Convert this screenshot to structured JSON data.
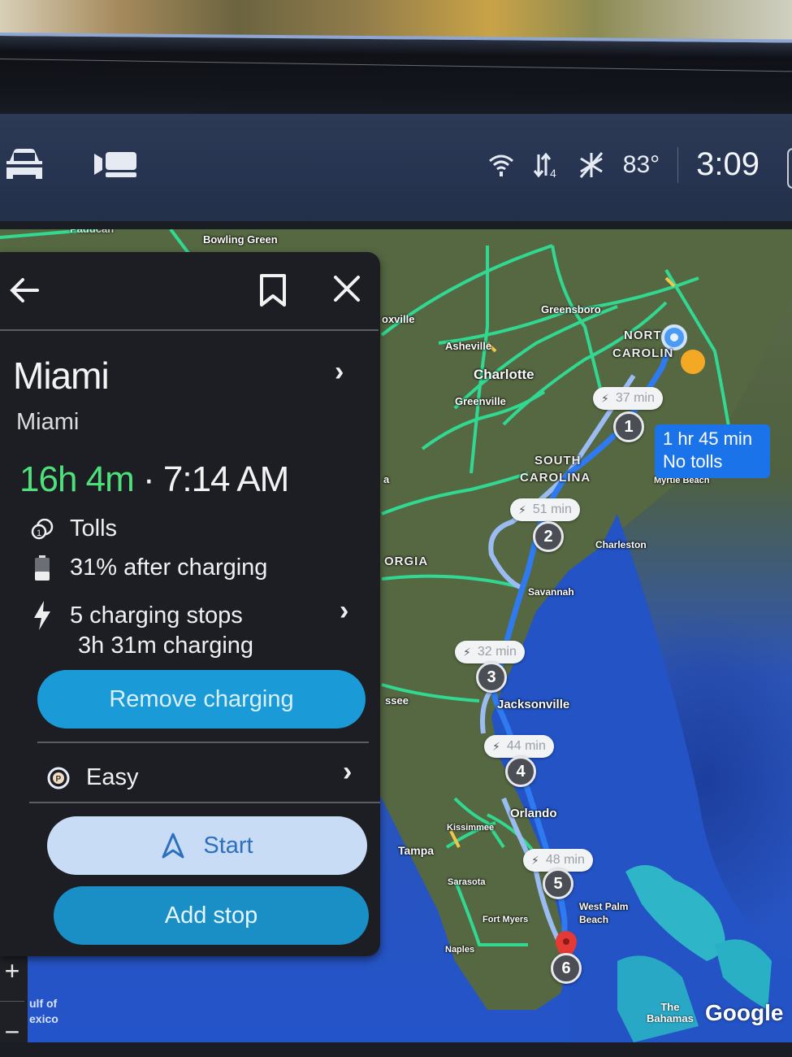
{
  "status_bar": {
    "icons": [
      "car-icon",
      "camera-icon",
      "wifi-icon",
      "data-transfer-icon",
      "climate-off-icon"
    ],
    "data_signal_label": "4",
    "temperature": "83°",
    "time": "3:09"
  },
  "panel": {
    "destination_title": "Miami",
    "destination_subtitle": "Miami",
    "duration": "16h 4m",
    "separator": "·",
    "arrival_time": "7:14 AM",
    "tolls_label": "Tolls",
    "battery_label": "31% after charging",
    "charging_stops_label": "5 charging stops",
    "charging_time_label": "3h 31m charging",
    "remove_charging_label": "Remove charging",
    "parking_label": "Easy",
    "start_label": "Start",
    "add_stop_label": "Add stop"
  },
  "map": {
    "labels": {
      "paducah": "Paducah",
      "bowling_green": "Bowling Green",
      "knoxville": "oxville",
      "asheville": "Asheville",
      "greensboro": "Greensboro",
      "charlotte": "Charlotte",
      "greenville": "Greenville",
      "north_carolina_1": "NORT",
      "north_carolina_2": "CAROLIN",
      "south_carolina_1": "SOUTH",
      "south_carolina_2": "CAROLINA",
      "myrtle_beach": "Myrtle Beach",
      "charleston": "Charleston",
      "georgia": "ORGIA",
      "savannah": "Savannah",
      "tennessee": "ssee",
      "jacksonville": "Jacksonville",
      "orlando": "Orlando",
      "kissimmee": "Kissimmee",
      "tampa": "Tampa",
      "sarasota": "Sarasota",
      "fort_myers": "Fort Myers",
      "naples": "Naples",
      "west_palm_1": "West Palm",
      "west_palm_2": "Beach",
      "gulf_1": "ulf of",
      "gulf_2": "exico",
      "bahamas_1": "The",
      "bahamas_2": "Bahamas",
      "a_fragment": "a"
    },
    "route_callout": {
      "line1": "1 hr 45 min",
      "line2": "No tolls"
    },
    "charging_stops": [
      {
        "number": "1",
        "duration": "37 min"
      },
      {
        "number": "2",
        "duration": "51 min"
      },
      {
        "number": "3",
        "duration": "32 min"
      },
      {
        "number": "4",
        "duration": "44 min"
      },
      {
        "number": "5",
        "duration": "48 min"
      }
    ],
    "destination_marker_label": "6",
    "attribution": "Google",
    "zoom_in": "+",
    "zoom_out": "−",
    "colors": {
      "route": "#2f7af0",
      "alt_route": "#9bbcf3",
      "traffic_green": "#2ee59a",
      "traffic_yellow": "#f3c54a",
      "water": "#2354c9",
      "pin": "#e53935"
    }
  }
}
